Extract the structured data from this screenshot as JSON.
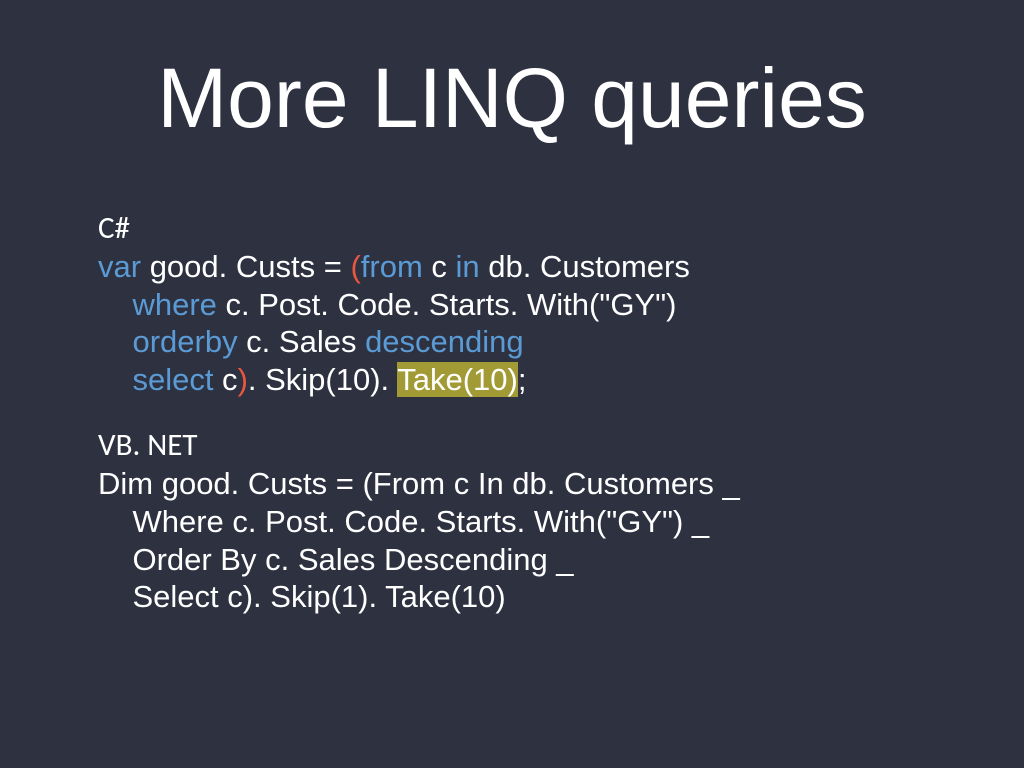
{
  "title": "More LINQ queries",
  "csharp": {
    "label": "C#",
    "kw_var": "var",
    "l1_a": " good. Custs = ",
    "l1_paren1": "(",
    "l1_from": "from",
    "l1_b": " c ",
    "l1_in": "in",
    "l1_c": " db. Customers",
    "l2_pad": "    ",
    "l2_where": "where",
    "l2_a": " c. Post. Code. Starts. With(\"GY\")",
    "l3_pad": "    ",
    "l3_orderby": "orderby",
    "l3_a": " c. Sales ",
    "l3_desc": "descending",
    "l4_pad": "    ",
    "l4_select": "select",
    "l4_a": " c",
    "l4_paren2": ")",
    "l4_b": ". Skip(10). ",
    "l4_take": "Take(10)",
    "l4_c": ";"
  },
  "vbnet": {
    "label": "VB. NET",
    "l1": "Dim good. Custs = (From c In db. Customers _",
    "l2": "    Where c. Post. Code. Starts. With(\"GY\") _",
    "l3": "    Order By c. Sales Descending _",
    "l4": "    Select c). Skip(1). Take(10)"
  }
}
